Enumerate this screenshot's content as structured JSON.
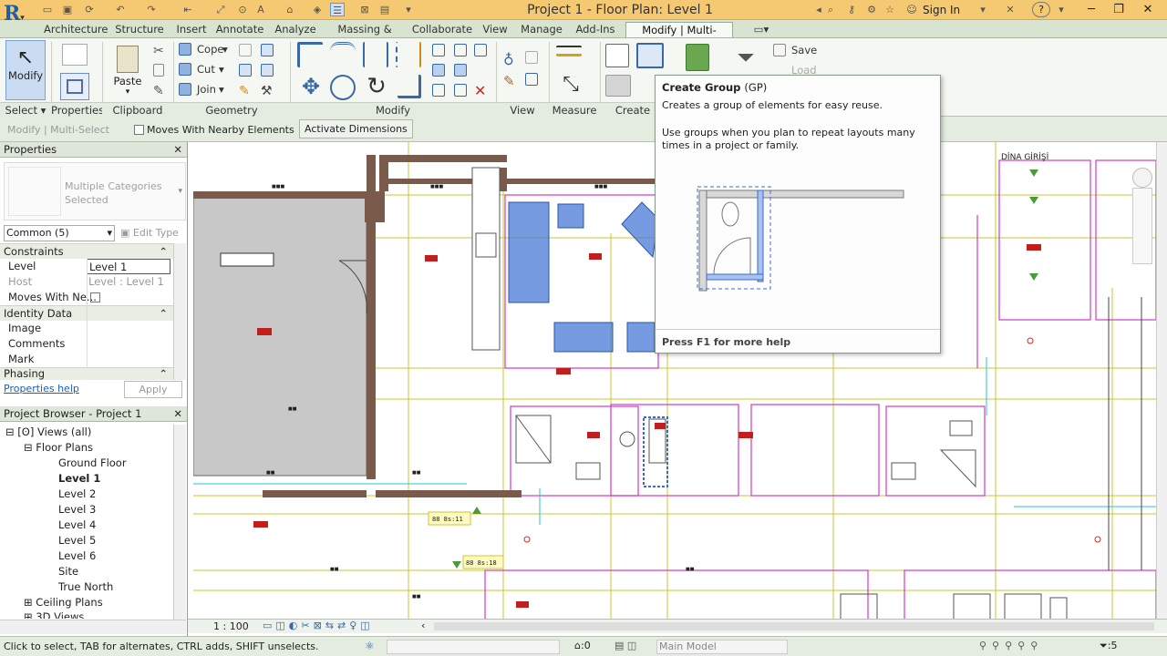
{
  "titlebar": {
    "title": "Project 1 - Floor Plan: Level 1",
    "sign_in": "Sign In",
    "help": "?"
  },
  "tabs": [
    "Architecture",
    "Structure",
    "Insert",
    "Annotate",
    "Analyze",
    "Massing & Site",
    "Collaborate",
    "View",
    "Manage",
    "Add-Ins",
    "Modify | Multi-Select"
  ],
  "ribbon": {
    "modify": "Modify",
    "paste": "Paste",
    "properties": "Properties",
    "cope": "Cope",
    "cut": "Cut",
    "join": "Join",
    "save": "Save",
    "load": "Load",
    "panels": [
      "Select",
      "Properties",
      "Clipboard",
      "Geometry",
      "Modify",
      "View",
      "Measure",
      "Create"
    ]
  },
  "optionsbar": {
    "context": "Modify | Multi-Select",
    "moves_with": "Moves With Nearby Elements",
    "activate_dimensions": "Activate Dimensions"
  },
  "properties": {
    "title": "Properties",
    "type_selector": "Multiple Categories Selected",
    "filter": "Common (5)",
    "edit_type": "Edit Type",
    "groups": {
      "constraints": "Constraints",
      "identity": "Identity Data",
      "phasing": "Phasing"
    },
    "rows": {
      "level_label": "Level",
      "level_value": "Level 1",
      "host_label": "Host",
      "host_value": "Level : Level 1",
      "moves_label": "Moves With Ne...",
      "image_label": "Image",
      "comments_label": "Comments",
      "mark_label": "Mark"
    },
    "help_link": "Properties help",
    "apply": "Apply"
  },
  "browser": {
    "title": "Project Browser - Project 1",
    "views": "Views (all)",
    "floor_plans": "Floor Plans",
    "items": [
      "Ground Floor",
      "Level 1",
      "Level 2",
      "Level 3",
      "Level 4",
      "Level 5",
      "Level 6",
      "Site",
      "True North"
    ],
    "ceiling_plans": "Ceiling Plans",
    "views_3d": "3D Views"
  },
  "tooltip": {
    "title": "Create Group",
    "shortcut": "(GP)",
    "desc": "Creates a group of elements for easy reuse.",
    "detail": "Use groups when you plan to repeat layouts many times in a project or family.",
    "footer": "Press F1 for more help"
  },
  "canvas": {
    "entrance_label": "DİNA GİRİŞİ",
    "tag1": "88 8s:11",
    "tag2": "88 8s:18"
  },
  "viewbar": {
    "scale": "1 : 100"
  },
  "statusbar": {
    "hint": "Click to select, TAB for alternates, CTRL adds, SHIFT unselects.",
    "zero": ":0",
    "model": "Main Model",
    "count": ":5"
  },
  "colors": {
    "accent": "#f4c971",
    "ribbon": "#f4f7f2",
    "selection": "#4472c4",
    "wall": "#7a5a4a"
  }
}
